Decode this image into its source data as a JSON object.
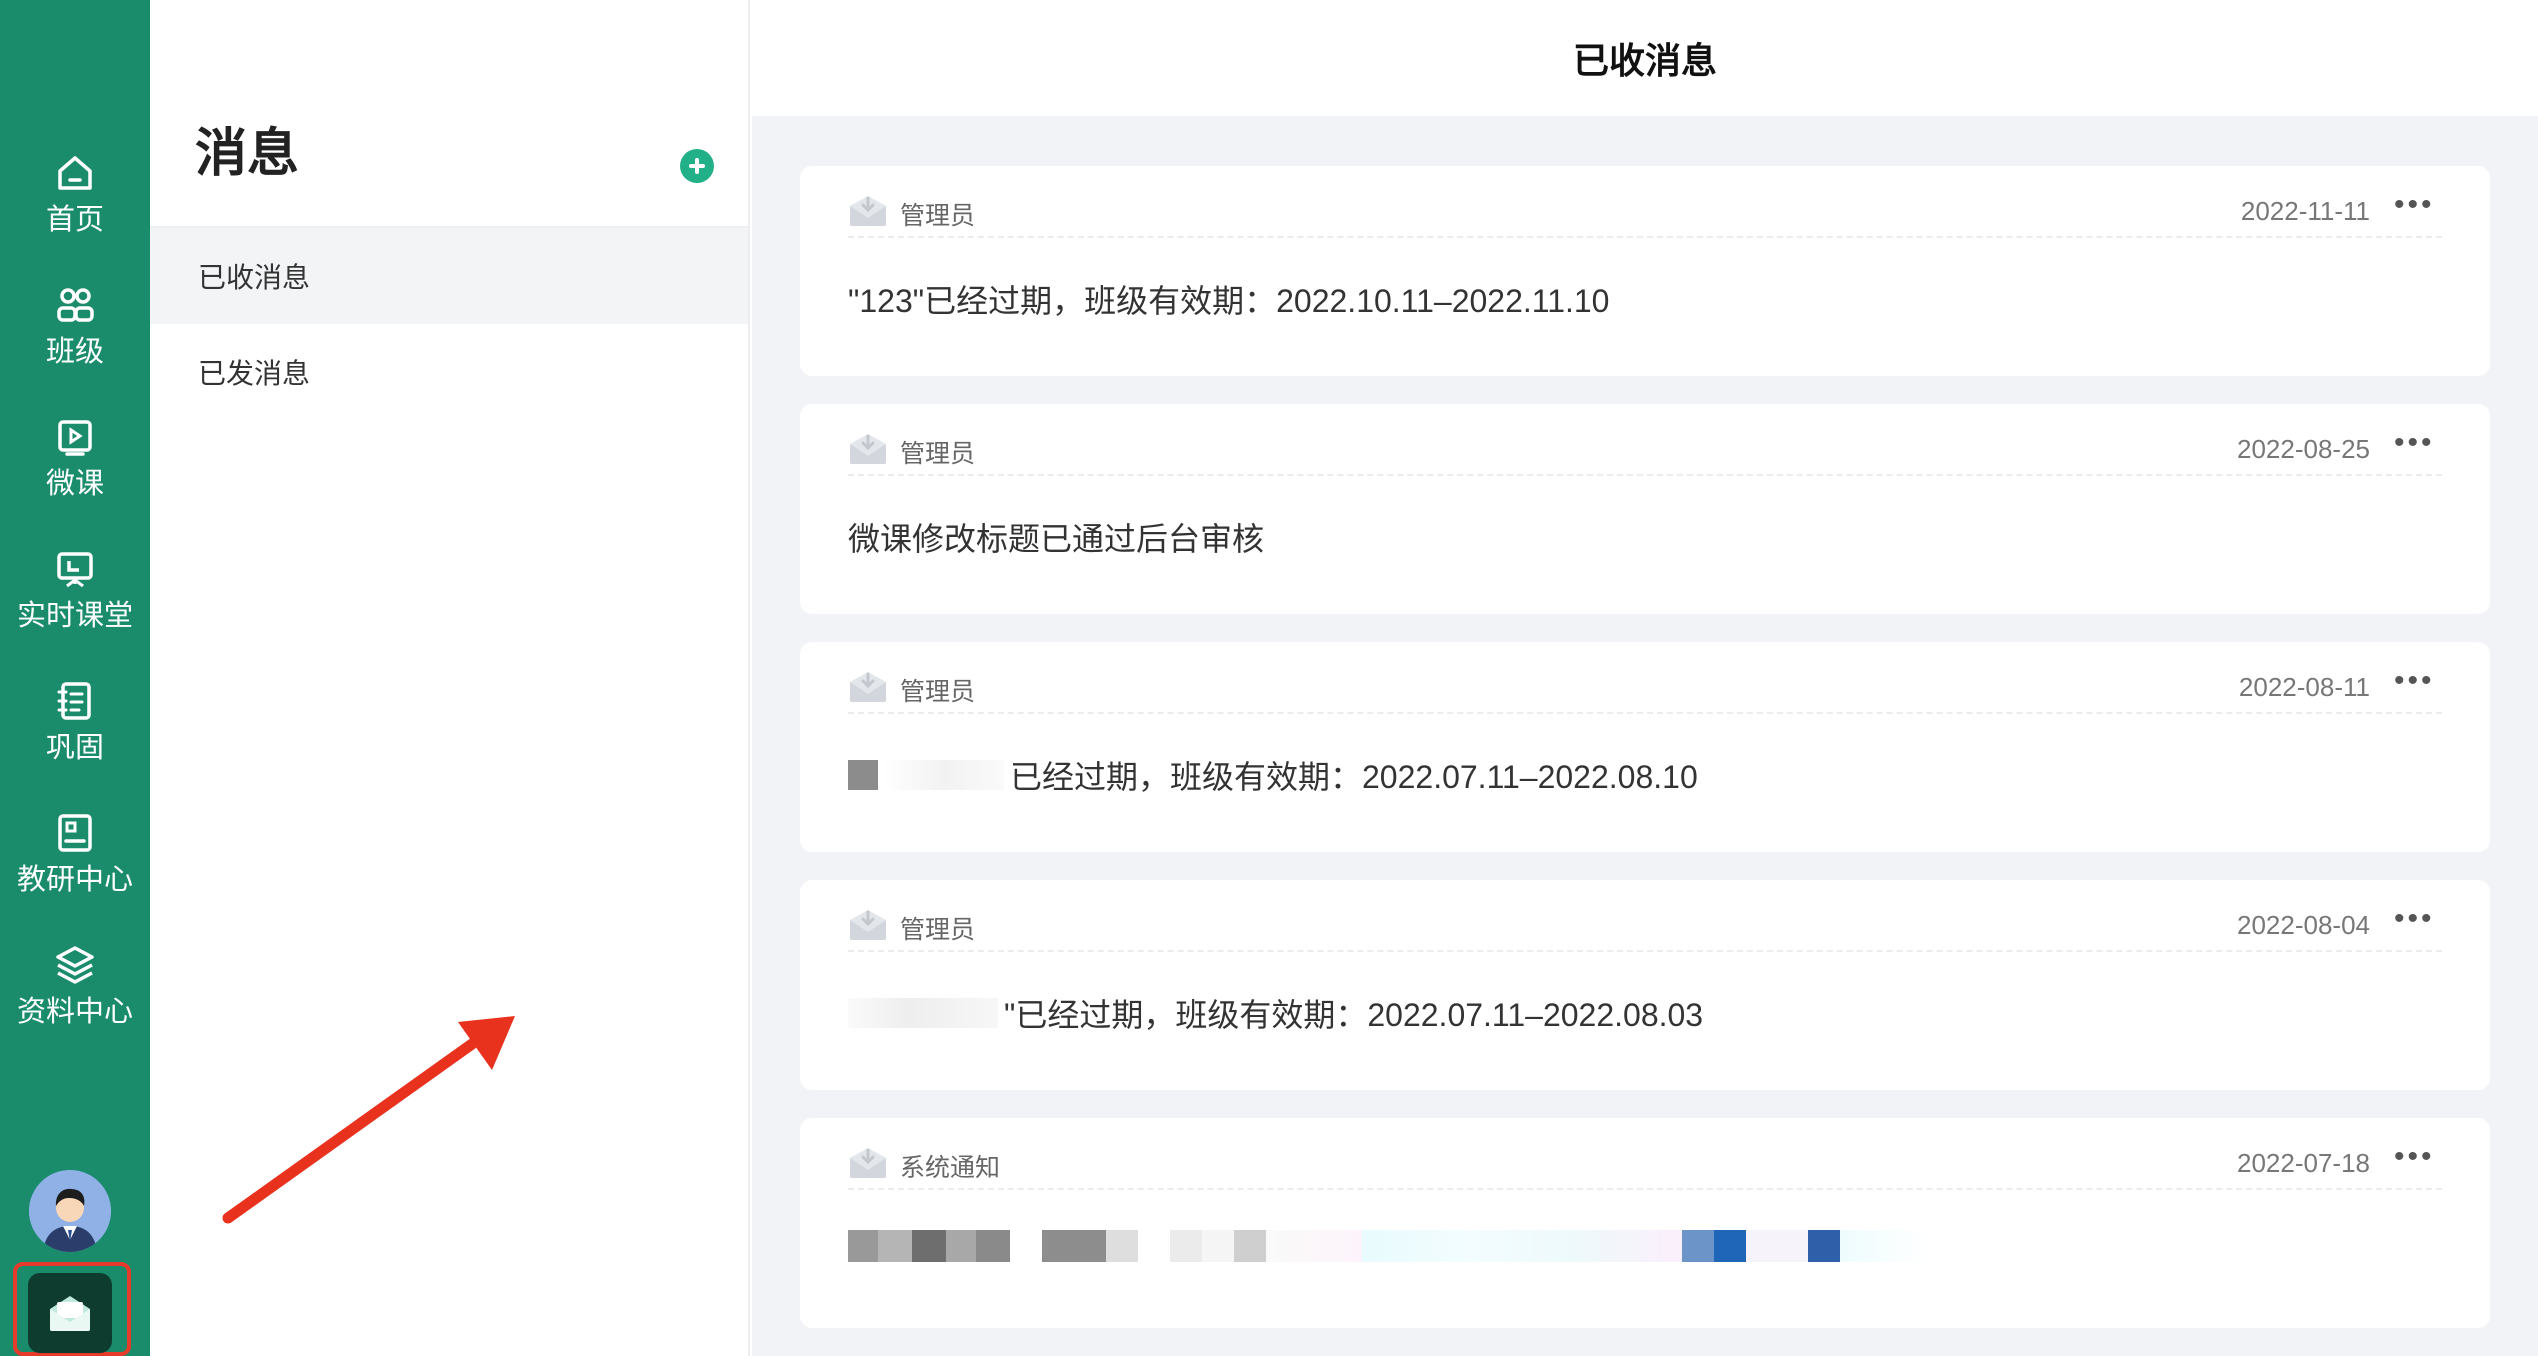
{
  "rail": {
    "items": [
      {
        "label": "首页",
        "icon": "home-icon"
      },
      {
        "label": "班级",
        "icon": "class-icon"
      },
      {
        "label": "微课",
        "icon": "micro-lesson-icon"
      },
      {
        "label": "实时课堂",
        "icon": "live-class-icon"
      },
      {
        "label": "巩固",
        "icon": "consolidate-icon"
      },
      {
        "label": "教研中心",
        "icon": "research-icon"
      },
      {
        "label": "资料中心",
        "icon": "layers-icon"
      }
    ],
    "avatar": "avatar-icon",
    "message_button": "mail-open-icon"
  },
  "sidebar": {
    "title": "消息",
    "add_icon": "plus-circle-icon",
    "items": [
      {
        "label": "已收消息",
        "active": true
      },
      {
        "label": "已发消息",
        "active": false
      }
    ]
  },
  "main": {
    "title": "已收消息",
    "messages": [
      {
        "sender": "管理员",
        "date": "2022-11-11",
        "content": "\"123\"已经过期，班级有效期：2022.10.11–2022.11.10"
      },
      {
        "sender": "管理员",
        "date": "2022-08-25",
        "content": "微课修改标题已通过后台审核"
      },
      {
        "sender": "管理员",
        "date": "2022-08-11",
        "content": "已经过期，班级有效期：2022.07.11–2022.08.10"
      },
      {
        "sender": "管理员",
        "date": "2022-08-04",
        "content": "\"已经过期，班级有效期：2022.07.11–2022.08.03"
      },
      {
        "sender": "系统通知",
        "date": "2022-07-18",
        "content": ""
      }
    ],
    "more_label": "•••"
  },
  "colors": {
    "rail_bg": "#1a8c6c",
    "accent": "#22b088",
    "highlight_frame": "#e63a2a",
    "annotation_arrow": "#e8321e"
  }
}
